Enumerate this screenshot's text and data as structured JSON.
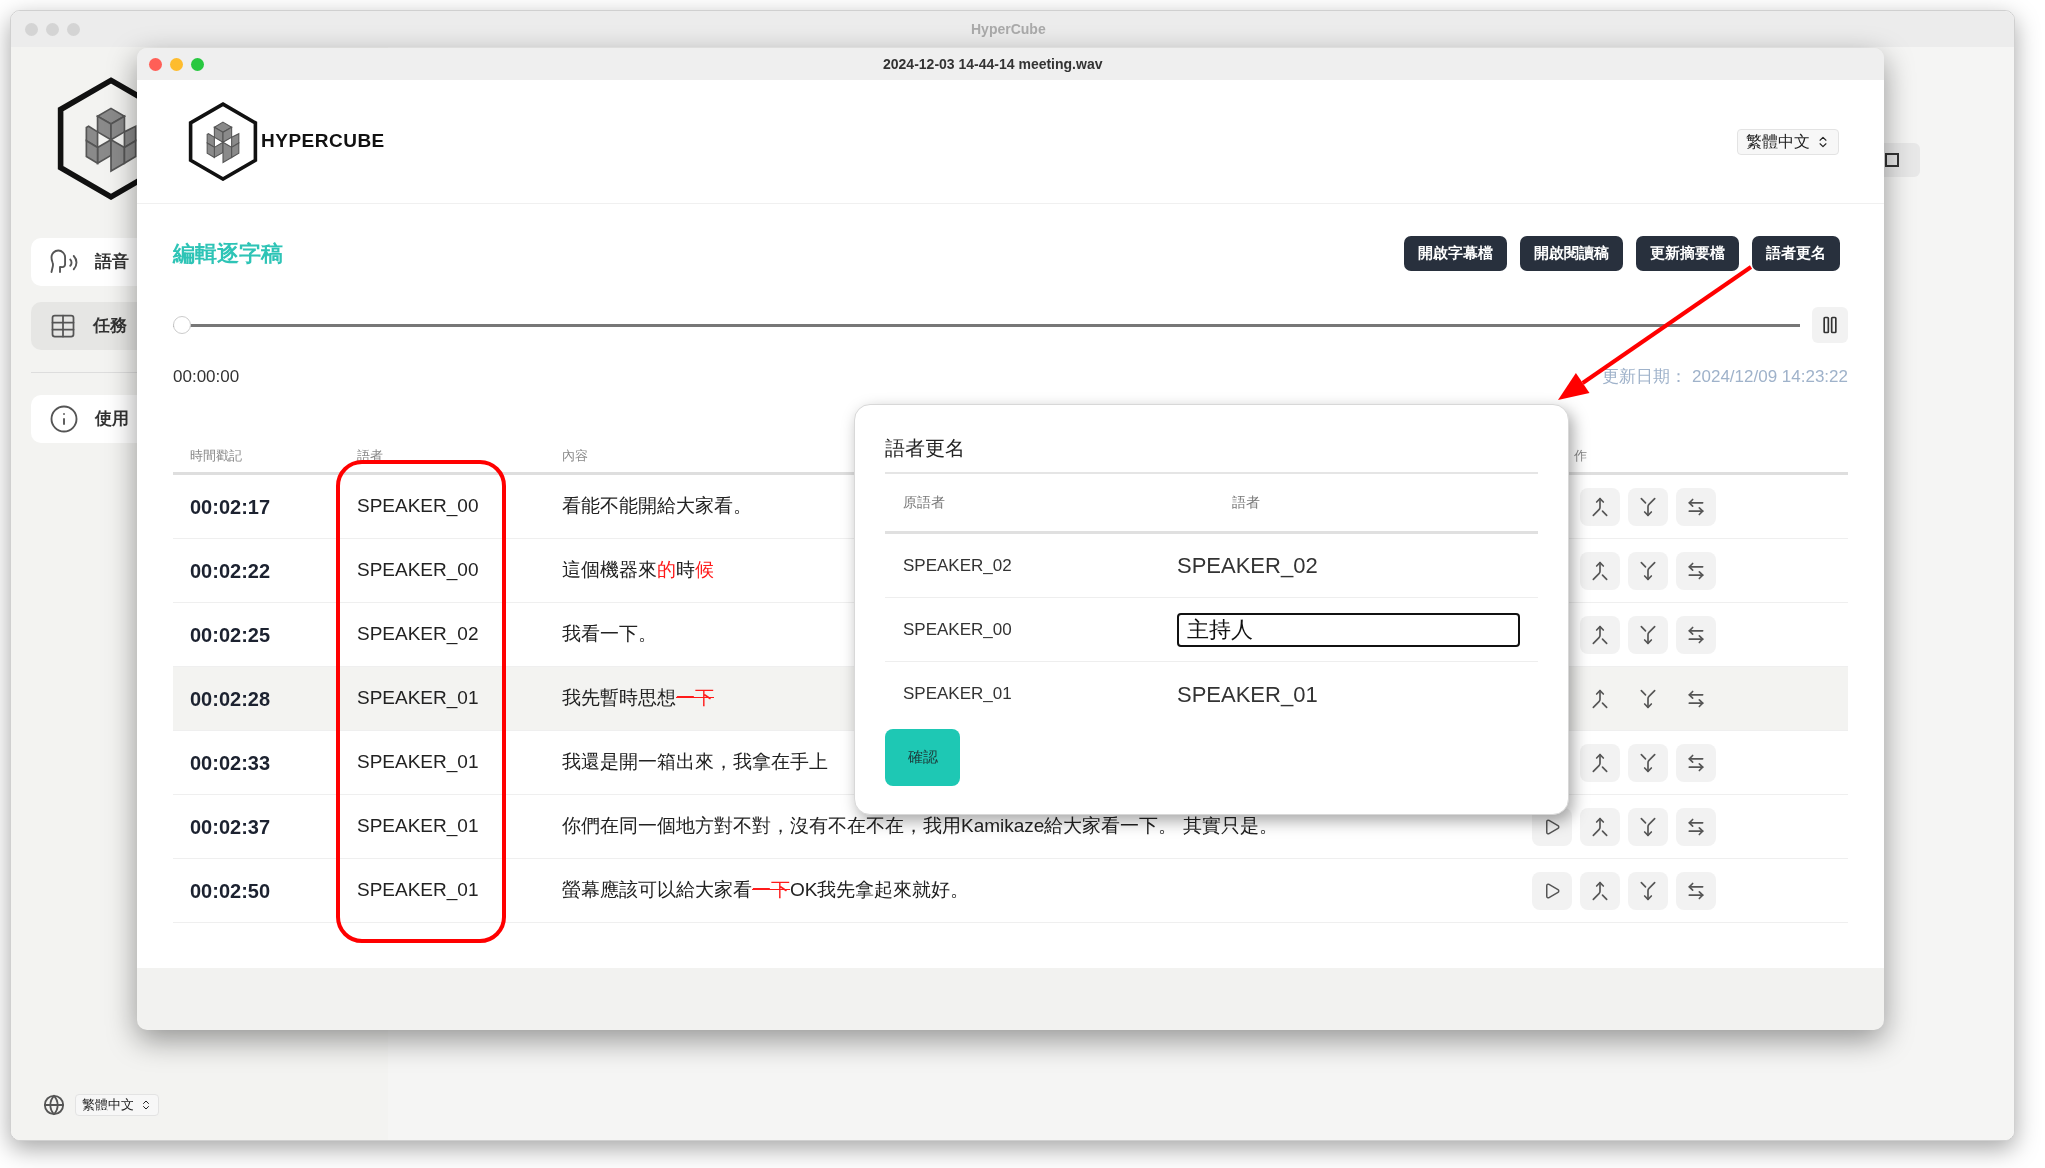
{
  "back_window": {
    "title": "HyperCube",
    "sidebar": {
      "items": [
        {
          "label": "語音",
          "kind": "speech",
          "selected": false
        },
        {
          "label": "任務",
          "kind": "table",
          "selected": true
        },
        {
          "label": "使用",
          "kind": "info",
          "selected": false
        }
      ]
    },
    "language_select": {
      "value": "繁體中文"
    }
  },
  "front_window": {
    "title": "2024-12-03 14-44-14 meeting.wav",
    "logo_text": "HYPERCUBE",
    "language_select": {
      "value": "繁體中文"
    },
    "page_title": "編輯逐字稿",
    "buttons": [
      "開啟字幕檔",
      "開啟閱讀稿",
      "更新摘要檔",
      "語者更名"
    ],
    "player": {
      "level": 0,
      "time": "00:00:00"
    },
    "last_updated": "更新日期： 2024/12/09 14:23:22",
    "table": {
      "columns": [
        "時間戳記",
        "語者",
        "內容",
        "作"
      ],
      "rows": [
        {
          "time": "00:02:17",
          "speaker": "SPEAKER_00",
          "highlighted": false,
          "play_button": false,
          "segments": [
            {
              "kind": "plain",
              "text": "看能不能開給大家看。"
            }
          ]
        },
        {
          "time": "00:02:22",
          "speaker": "SPEAKER_00",
          "highlighted": false,
          "play_button": false,
          "segments": [
            {
              "kind": "plain",
              "text": "這個機器來"
            },
            {
              "kind": "changed",
              "text": "的"
            },
            {
              "kind": "plain",
              "text": "時"
            },
            {
              "kind": "changed",
              "text": "候"
            }
          ]
        },
        {
          "time": "00:02:25",
          "speaker": "SPEAKER_02",
          "highlighted": false,
          "play_button": false,
          "segments": [
            {
              "kind": "plain",
              "text": "我看一下。"
            }
          ]
        },
        {
          "time": "00:02:28",
          "speaker": "SPEAKER_01",
          "highlighted": true,
          "play_button": false,
          "segments": [
            {
              "kind": "plain",
              "text": "我先暫時思想"
            },
            {
              "kind": "deleted",
              "text": "一下"
            }
          ]
        },
        {
          "time": "00:02:33",
          "speaker": "SPEAKER_01",
          "highlighted": false,
          "play_button": false,
          "segments": [
            {
              "kind": "plain",
              "text": "我還是開一箱出來，我拿在手上"
            }
          ]
        },
        {
          "time": "00:02:37",
          "speaker": "SPEAKER_01",
          "highlighted": false,
          "play_button": true,
          "segments": [
            {
              "kind": "plain",
              "text": "你們在同一個地方對不對，沒有不在不在，我用Kamikaze給大家看一下。 其實只是。"
            }
          ]
        },
        {
          "time": "00:02:50",
          "speaker": "SPEAKER_01",
          "highlighted": false,
          "play_button": true,
          "segments": [
            {
              "kind": "plain",
              "text": "螢幕應該可以給大家看"
            },
            {
              "kind": "deleted",
              "text": "一下"
            },
            {
              "kind": "plain",
              "text": "OK我先拿起來就好。"
            }
          ]
        }
      ]
    }
  },
  "dialog": {
    "title": "語者更名",
    "columns": [
      "原語者",
      "語者"
    ],
    "rows": [
      {
        "original": "SPEAKER_02",
        "name": "SPEAKER_02",
        "editing": false
      },
      {
        "original": "SPEAKER_00",
        "name": "主持人",
        "editing": true
      },
      {
        "original": "SPEAKER_01",
        "name": "SPEAKER_01",
        "editing": false
      }
    ],
    "confirm": "確認"
  }
}
